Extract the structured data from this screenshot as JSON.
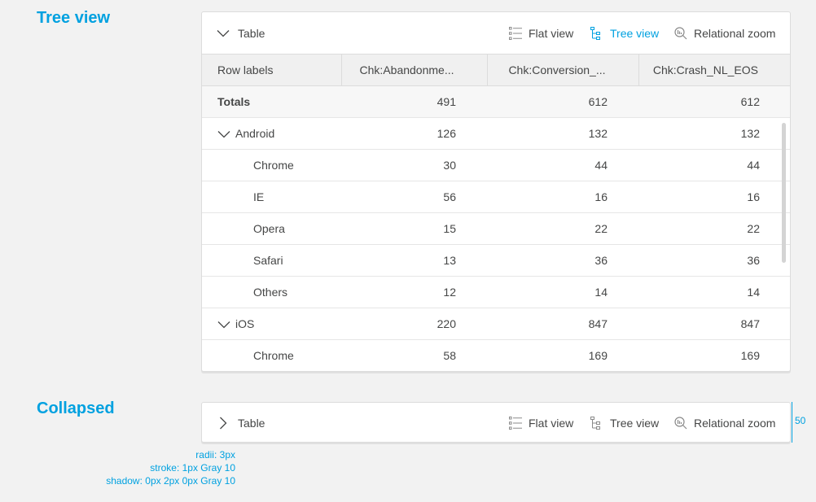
{
  "sections": {
    "tree_title": "Tree view",
    "collapsed_title": "Collapsed"
  },
  "panel": {
    "title": "Table",
    "views": {
      "flat": "Flat view",
      "tree": "Tree view",
      "relational": "Relational zoom"
    },
    "active_view": "tree"
  },
  "table": {
    "columns": [
      "Row labels",
      "Chk:Abandonme...",
      "Chk:Conversion_...",
      "Chk:Crash_NL_EOS"
    ],
    "totals": {
      "label": "Totals",
      "values": [
        "491",
        "612",
        "612"
      ]
    },
    "groups": [
      {
        "label": "Android",
        "expanded": true,
        "values": [
          "126",
          "132",
          "132"
        ],
        "children": [
          {
            "label": "Chrome",
            "values": [
              "30",
              "44",
              "44"
            ]
          },
          {
            "label": "IE",
            "values": [
              "56",
              "16",
              "16"
            ]
          },
          {
            "label": "Opera",
            "values": [
              "15",
              "22",
              "22"
            ]
          },
          {
            "label": "Safari",
            "values": [
              "13",
              "36",
              "36"
            ]
          },
          {
            "label": "Others",
            "values": [
              "12",
              "14",
              "14"
            ]
          }
        ]
      },
      {
        "label": "iOS",
        "expanded": true,
        "values": [
          "220",
          "847",
          "847"
        ],
        "children": [
          {
            "label": "Chrome",
            "values": [
              "58",
              "169",
              "169"
            ]
          }
        ]
      }
    ]
  },
  "spec": {
    "radii": "radii: 3px",
    "stroke": "stroke: 1px Gray 10",
    "shadow": "shadow: 0px 2px 0px Gray 10",
    "height": "50"
  },
  "icons": {
    "expand": "chevron-down-icon",
    "collapse": "chevron-right-icon",
    "flat": "list-icon",
    "tree": "tree-icon",
    "relational": "zoom-icon"
  },
  "colors": {
    "accent": "#00a1e0",
    "text": "#454646",
    "header_bg": "#f0f0f0",
    "border": "#dcdcdc"
  }
}
